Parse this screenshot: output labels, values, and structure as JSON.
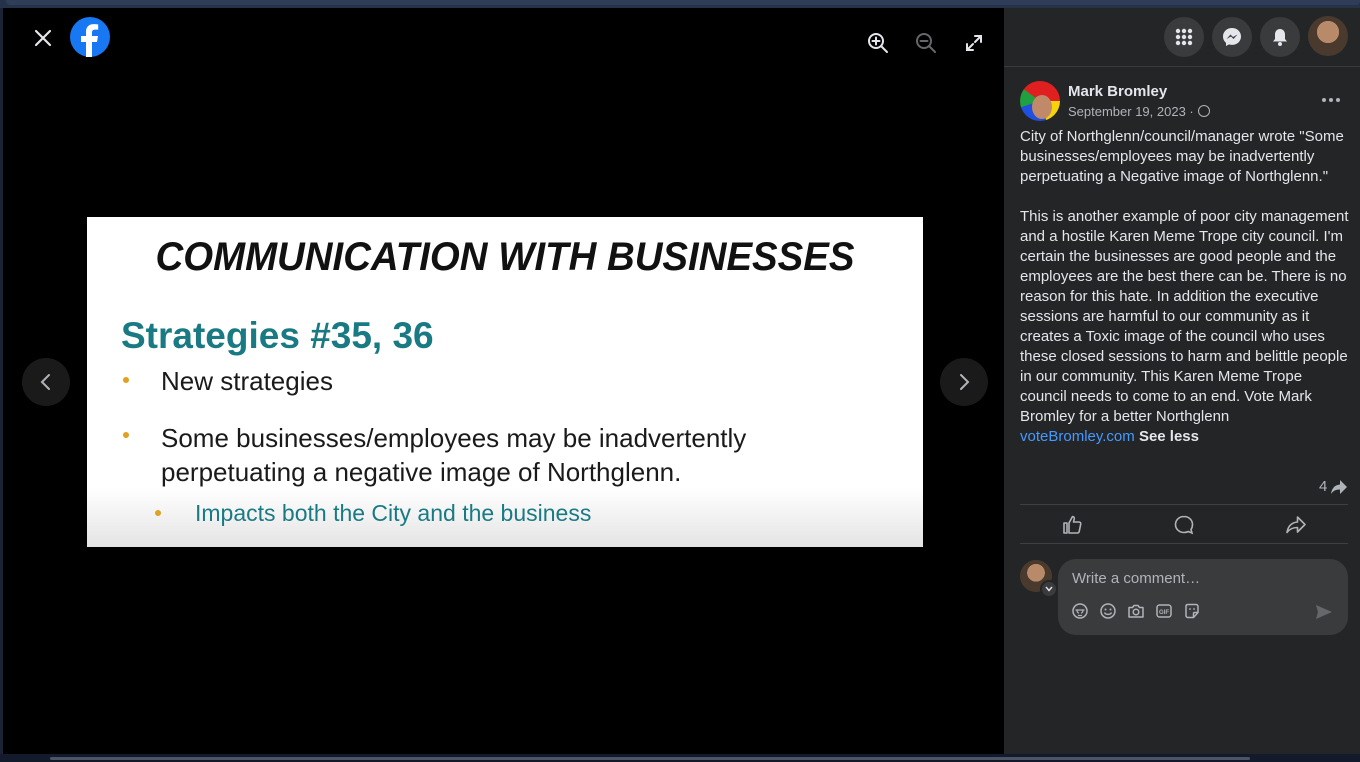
{
  "viewer": {
    "slide": {
      "title": "COMMUNICATION WITH BUSINESSES",
      "subtitle": "Strategies #35, 36",
      "bullet1": "New strategies",
      "bullet2": "Some businesses/employees may be inadvertently perpetuating a negative image of Northglenn.",
      "sub_bullet": "Impacts both the City and the business"
    },
    "icons": [
      "close-icon",
      "facebook-logo-icon",
      "zoom-in-icon",
      "zoom-out-icon",
      "fullscreen-icon",
      "chevron-left-icon",
      "chevron-right-icon"
    ]
  },
  "post": {
    "author": "Mark Bromley",
    "date": "September 19, 2023 ·",
    "paragraph1": "City of Northglenn/council/manager wrote \"Some businesses/employees may be inadvertently perpetuating a Negative image of Northglenn.\"",
    "paragraph2": "This is another example of poor city management and a hostile Karen Meme Trope city council. I'm certain the businesses are good people and the employees are the best there can be. There is no reason for this hate. In addition the executive sessions are harmful to our community as it creates a Toxic image of the council who uses these closed sessions to harm and belittle people in our community. This Karen Meme Trope council needs to come to an end. Vote Mark Bromley for a better Northglenn",
    "link": "voteBromley.com",
    "see_less": "See less",
    "share_count": "4"
  },
  "comment": {
    "placeholder": "Write a comment…"
  },
  "colors": {
    "facebook_blue": "#1877f2",
    "panel_bg": "#242526",
    "link": "#4599ff",
    "slide_teal": "#1a7a84"
  }
}
